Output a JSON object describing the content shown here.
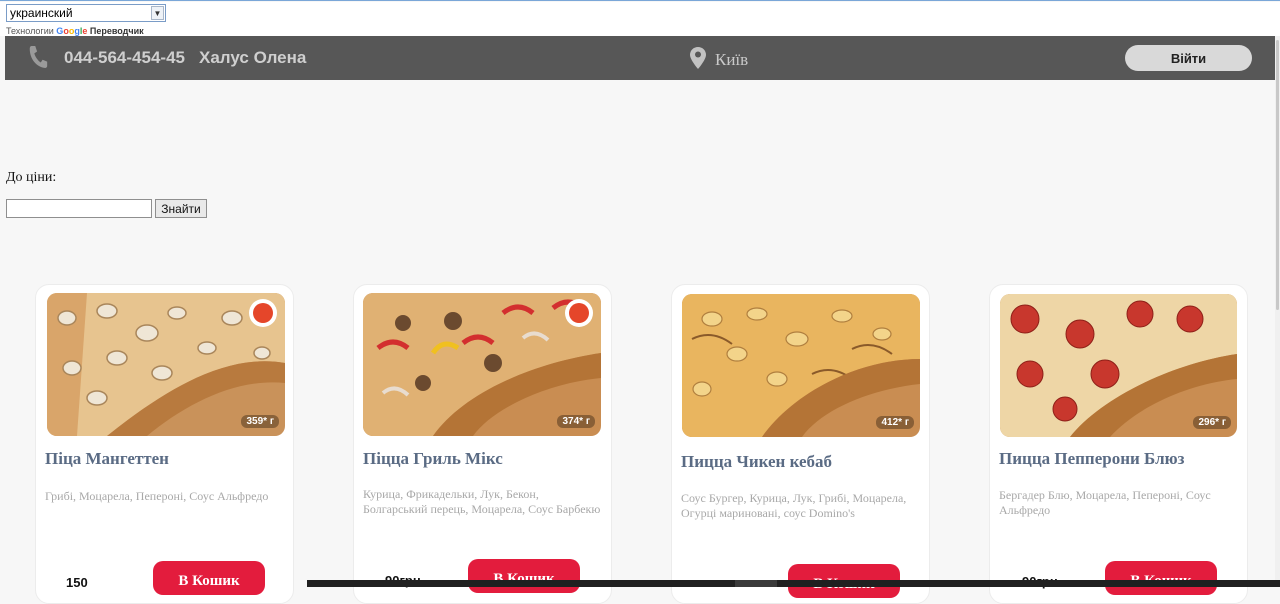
{
  "translate": {
    "language_selected": "украинский",
    "powered_prefix": "Технологии",
    "powered_brand": [
      "G",
      "o",
      "o",
      "g",
      "l",
      "e"
    ],
    "powered_suffix": "Переводчик"
  },
  "header": {
    "phone": "044-564-454-45",
    "user_name": "Халус Олена",
    "city": "Київ",
    "login_label": "Війти"
  },
  "filter": {
    "price_label": "До ціни:",
    "price_value": "",
    "search_label": "Знайти"
  },
  "products": [
    {
      "title": "Піца Мангеттен",
      "description": "Грибі, Моцарела, Пепероні, Соус Альфредо",
      "weight": "359* г",
      "price": "150",
      "cart_label": "В Кошик",
      "promo": true
    },
    {
      "title": "Піцца Гриль Мікс",
      "description": "Курица, Фрикадельки, Лук, Бекон, Болгарський перець, Моцарела, Соус Барбекю",
      "weight": "374* г",
      "price": "90грн",
      "cart_label": "В Кошик",
      "promo": true
    },
    {
      "title": "Пицца Чикен кебаб",
      "description": "Соус Бургер, Курица, Лук, Грибі, Моцарела, Огурці мариновані, соус Domino's",
      "weight": "412* г",
      "price": "",
      "cart_label": "В Кошик",
      "promo": false
    },
    {
      "title": "Пицца Пепперони Блюз",
      "description": "Бергадер Блю, Моцарела, Пепероні, Соус Альфредо",
      "weight": "296* г",
      "price": "90грн",
      "cart_label": "В Кошик",
      "promo": false
    }
  ],
  "colors": {
    "header_bg": "#575757",
    "cart_button": "#e31c3d",
    "title_text": "#5a6b84"
  },
  "icons": [
    "phone-icon",
    "location-pin-icon",
    "dropdown-arrow-icon"
  ]
}
